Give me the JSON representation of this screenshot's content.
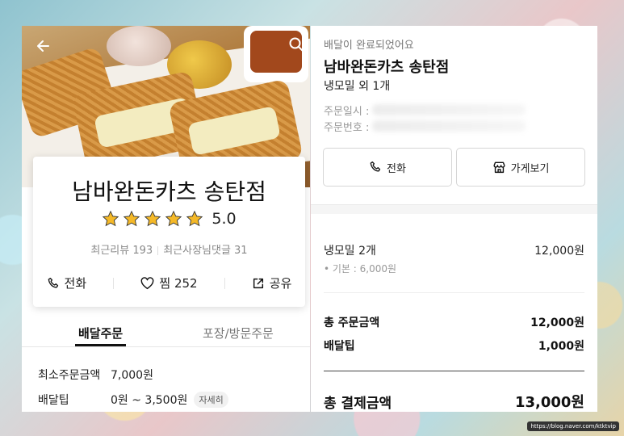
{
  "left_panel": {
    "store_name": "남바완돈카츠 송탄점",
    "rating_value": "5.0",
    "rating_stars": 5,
    "recent_reviews": "최근리뷰 193",
    "owner_replies": "최근사장님댓글 31",
    "actions": {
      "call": "전화",
      "favorite": "찜 252",
      "share": "공유"
    },
    "tabs": {
      "delivery": "배달주문",
      "pickup": "포장/방문주문"
    },
    "min_order_label": "최소주문금액",
    "min_order_value": "7,000원",
    "delivery_tip_label": "배달팁",
    "delivery_tip_value": "0원 ~ 3,500원",
    "delivery_tip_chip": "자세히"
  },
  "right_panel": {
    "status": "배달이 완료되었어요",
    "store_name": "남바완돈카츠 송탄점",
    "items_summary": "냉모밀 외 1개",
    "order_date_label": "주문일시 :",
    "order_number_label": "주문번호 :",
    "call_button": "전화",
    "store_button": "가게보기",
    "menu_name": "냉모밀 2개",
    "menu_price": "12,000원",
    "menu_option": "• 기본 : 6,000원",
    "subtotal_label": "총 주문금액",
    "subtotal_value": "12,000원",
    "delivery_tip_label": "배달팁",
    "delivery_tip_value": "1,000원",
    "total_label": "총 결제금액",
    "total_value": "13,000원"
  },
  "watermark": "https://blog.naver.com/ktktvip",
  "colors": {
    "star": "#f5b928",
    "text_primary": "#111111",
    "text_muted": "#999999"
  }
}
